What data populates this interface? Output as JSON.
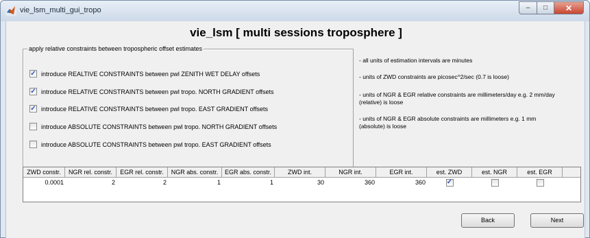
{
  "window": {
    "title": "vie_lsm_multi_gui_tropo",
    "minimize_glyph": "–",
    "maximize_glyph": "□",
    "close_glyph": "✕",
    "app_icon": "matlab-icon"
  },
  "heading": "vie_lsm [  multi sessions troposphere ]",
  "constraints_group": {
    "title": "apply relative constraints between tropospheric offset estimates",
    "options": [
      {
        "label": "introduce REALTIVE CONSTRAINTS between pwl ZENITH WET DELAY offsets",
        "checked": true
      },
      {
        "label": "introduce RELATIVE CONSTRAINTS between pwl tropo. NORTH GRADIENT offsets",
        "checked": true
      },
      {
        "label": "introduce RELATIVE CONSTRAINTS between pwl tropo. EAST GRADIENT offsets",
        "checked": true
      },
      {
        "label": "introduce ABSOLUTE CONSTRAINTS between pwl tropo. NORTH GRADIENT offsets",
        "checked": false
      },
      {
        "label": "introduce ABSOLUTE CONSTRAINTS between pwl tropo. EAST GRADIENT offsets",
        "checked": false
      }
    ]
  },
  "info_notes": [
    "- all units of estimation intervals are minutes",
    "- units of ZWD constraints are picosec^2/sec (0.7 is loose)",
    "- units of NGR & EGR relative constraints are millimeters/day e.g. 2 mm/day (relative) is loose",
    "- units of NGR & EGR absolute constraints are millimeters e.g. 1 mm (absolute) is loose"
  ],
  "table": {
    "columns": [
      "ZWD constr.",
      "NGR rel. constr.",
      "EGR rel. constr.",
      "NGR abs. constr.",
      "EGR abs. constr.",
      "ZWD int.",
      "NGR int.",
      "EGR int.",
      "est. ZWD",
      "est. NGR",
      "est. EGR"
    ],
    "row": [
      "0.0001",
      "2",
      "2",
      "1",
      "1",
      "30",
      "360",
      "360"
    ],
    "est_checks": [
      true,
      false,
      false
    ]
  },
  "buttons": {
    "back": "Back",
    "next": "Next"
  },
  "tick_glyph": "✓"
}
